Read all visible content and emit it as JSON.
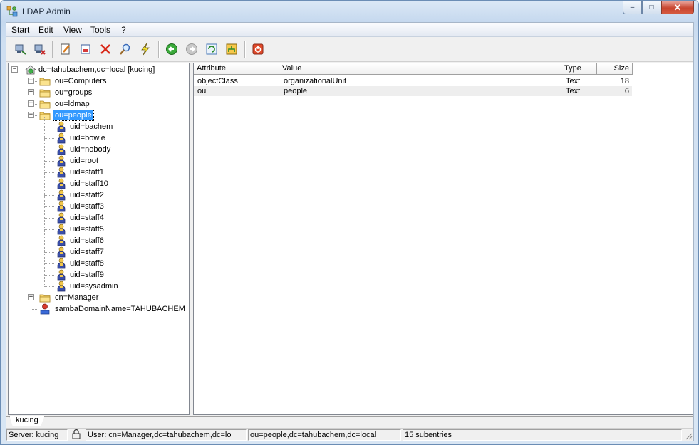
{
  "window": {
    "title": "LDAP Admin",
    "minimize_label": "–",
    "maximize_label": "□",
    "close_label": "✕"
  },
  "menu": [
    {
      "label": "Start"
    },
    {
      "label": "Edit"
    },
    {
      "label": "View"
    },
    {
      "label": "Tools"
    },
    {
      "label": "?"
    }
  ],
  "toolbar": {
    "buttons": [
      {
        "icon": "connect-icon"
      },
      {
        "icon": "disconnect-icon"
      },
      {
        "icon": "edit-entry-icon"
      },
      {
        "icon": "new-entry-icon"
      },
      {
        "icon": "delete-icon"
      },
      {
        "icon": "search-icon"
      },
      {
        "icon": "lightning-icon"
      },
      {
        "icon": "back-icon"
      },
      {
        "icon": "forward-icon"
      },
      {
        "icon": "refresh-icon"
      },
      {
        "icon": "schema-icon"
      },
      {
        "icon": "exit-icon"
      }
    ]
  },
  "tree": {
    "root": {
      "label": "dc=tahubachem,dc=local [kucing]",
      "expander": "−"
    },
    "nodes": [
      {
        "label": "ou=Computers",
        "expander": "+"
      },
      {
        "label": "ou=groups",
        "expander": "+"
      },
      {
        "label": "ou=ldmap",
        "expander": "+"
      },
      {
        "label": "ou=people",
        "expander": "−",
        "selected": true
      },
      {
        "label": "cn=Manager",
        "expander": "+"
      },
      {
        "label": "sambaDomainName=TAHUBACHEM"
      }
    ],
    "people": [
      "uid=bachem",
      "uid=bowie",
      "uid=nobody",
      "uid=root",
      "uid=staff1",
      "uid=staff10",
      "uid=staff2",
      "uid=staff3",
      "uid=staff4",
      "uid=staff5",
      "uid=staff6",
      "uid=staff7",
      "uid=staff8",
      "uid=staff9",
      "uid=sysadmin"
    ]
  },
  "grid": {
    "columns": [
      "Attribute",
      "Value",
      "Type",
      "Size"
    ],
    "rows": [
      {
        "attribute": "objectClass",
        "value": "organizationalUnit",
        "type": "Text",
        "size": "18"
      },
      {
        "attribute": "ou",
        "value": "people",
        "type": "Text",
        "size": "6"
      }
    ]
  },
  "tabs": [
    {
      "label": "kucing"
    }
  ],
  "status": {
    "server": "Server: kucing",
    "user": "User: cn=Manager,dc=tahubachem,dc=lo",
    "dn": "ou=people,dc=tahubachem,dc=local",
    "subentries": "15 subentries"
  },
  "colors": {
    "selection": "#3399ff",
    "close_button": "#c8452f",
    "folder": "#f5d36b"
  }
}
